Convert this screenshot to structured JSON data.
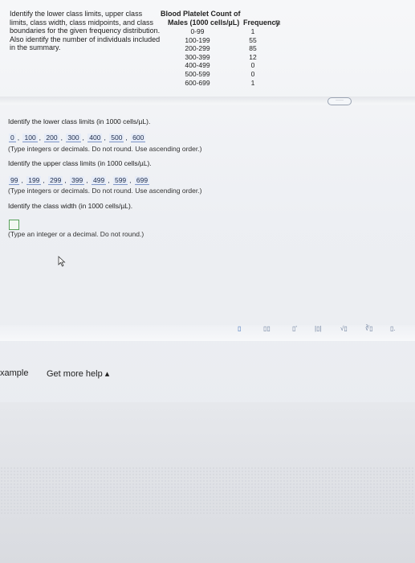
{
  "problem": {
    "instructions": "Identify the lower class limits, upper class limits, class width, class midpoints, and class boundaries for the given frequency distribution. Also identify the number of individuals included in the summary.",
    "table_title": "Blood Platelet Count of",
    "col_class": "Males (1000 cells/µL)",
    "col_freq": "Frequency",
    "copy_icon": "copy-icon",
    "classes": [
      "0-99",
      "100-199",
      "200-299",
      "300-399",
      "400-499",
      "500-599",
      "600-699"
    ],
    "frequencies": [
      "1",
      "55",
      "85",
      "12",
      "0",
      "0",
      "1"
    ]
  },
  "more_button": "·····",
  "q1": {
    "label": "Identify the lower class limits (in 1000 cells/µL).",
    "answers": [
      "0",
      "100",
      "200",
      "300",
      "400",
      "500",
      "600"
    ],
    "hint": "(Type integers or decimals. Do not round. Use ascending order.)"
  },
  "q2": {
    "label": "Identify the upper class limits (in 1000 cells/µL).",
    "answers": [
      "99",
      "199",
      "299",
      "399",
      "499",
      "599",
      "699"
    ],
    "hint": "(Type integers or decimals. Do not round. Use ascending order.)"
  },
  "q3": {
    "label": "Identify the class width (in 1000 cells/µL).",
    "value": "",
    "hint": "(Type an integer or a decimal. Do not round.)"
  },
  "toolbar": {
    "items": [
      {
        "icon": "fraction-icon",
        "symbol": "▯"
      },
      {
        "icon": "mixed-number-icon",
        "symbol": "▯▯"
      },
      {
        "icon": "exponent-icon",
        "symbol": "▯'"
      },
      {
        "icon": "absolute-value-icon",
        "symbol": "|▯|"
      },
      {
        "icon": "sqrt-icon",
        "symbol": "√▯"
      },
      {
        "icon": "nth-root-icon",
        "symbol": "∛▯"
      },
      {
        "icon": "decimal-icon",
        "symbol": "▯."
      }
    ]
  },
  "footer": {
    "example": "xample",
    "help": "Get more help ▴"
  }
}
